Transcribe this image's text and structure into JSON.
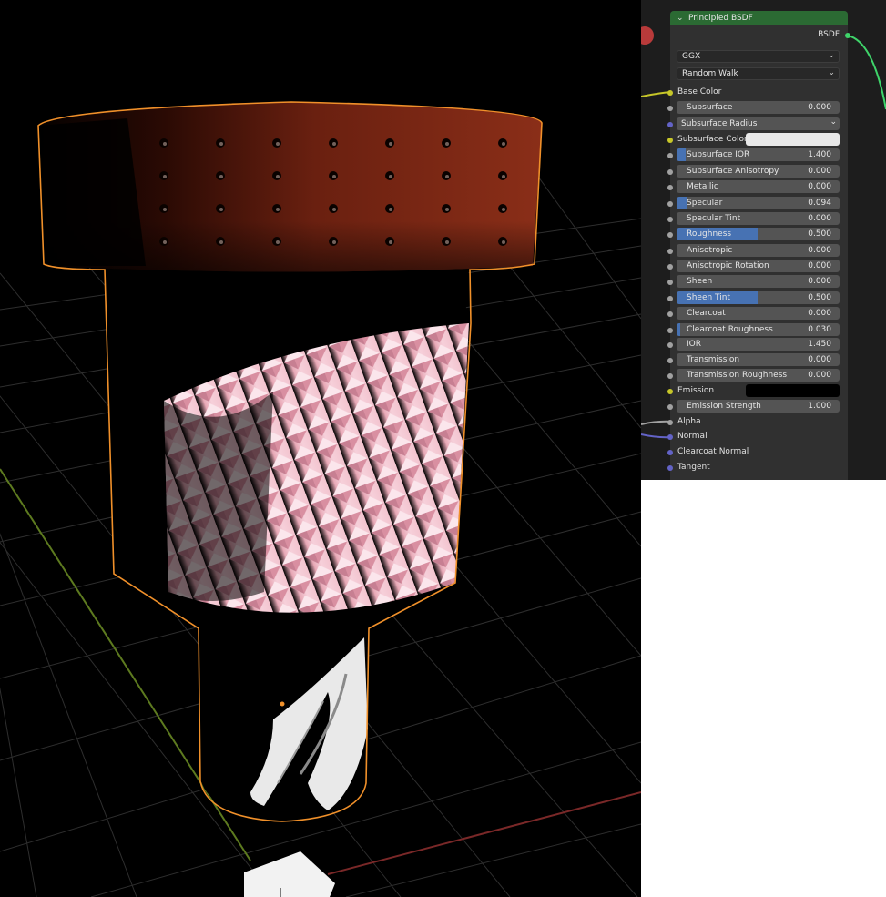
{
  "node": {
    "title": "Principled BSDF",
    "output_label": "BSDF",
    "distribution": "GGX",
    "subsurface_method": "Random Walk",
    "collapse_glyph": "⌄",
    "dropdown_arrow": "⌄"
  },
  "inputs": {
    "base_color": "Base Color",
    "subsurface": {
      "label": "Subsurface",
      "value": "0.000"
    },
    "subsurface_radius": "Subsurface Radius",
    "subsurface_color": "Subsurface Color",
    "subsurface_ior": {
      "label": "Subsurface IOR",
      "value": "1.400"
    },
    "subsurface_anisotropy": {
      "label": "Subsurface Anisotropy",
      "value": "0.000"
    },
    "metallic": {
      "label": "Metallic",
      "value": "0.000"
    },
    "specular": {
      "label": "Specular",
      "value": "0.094"
    },
    "specular_tint": {
      "label": "Specular Tint",
      "value": "0.000"
    },
    "roughness": {
      "label": "Roughness",
      "value": "0.500"
    },
    "anisotropic": {
      "label": "Anisotropic",
      "value": "0.000"
    },
    "anisotropic_rotation": {
      "label": "Anisotropic Rotation",
      "value": "0.000"
    },
    "sheen": {
      "label": "Sheen",
      "value": "0.000"
    },
    "sheen_tint": {
      "label": "Sheen Tint",
      "value": "0.500"
    },
    "clearcoat": {
      "label": "Clearcoat",
      "value": "0.000"
    },
    "clearcoat_roughness": {
      "label": "Clearcoat Roughness",
      "value": "0.030"
    },
    "ior": {
      "label": "IOR",
      "value": "1.450"
    },
    "transmission": {
      "label": "Transmission",
      "value": "0.000"
    },
    "transmission_roughness": {
      "label": "Transmission Roughness",
      "value": "0.000"
    },
    "emission": "Emission",
    "emission_strength": {
      "label": "Emission Strength",
      "value": "1.000"
    },
    "alpha": "Alpha",
    "normal": "Normal",
    "clearcoat_normal": "Clearcoat Normal",
    "tangent": "Tangent"
  },
  "colors": {
    "node_header": "#2b6a33",
    "slider_fill": "#4772b3",
    "selection_outline": "#f0902a",
    "subsurface_color_swatch": "#e8e8e8",
    "emission_color_swatch": "#000000",
    "socket_color": "#c7c729",
    "socket_float": "#a1a1a1",
    "socket_vector": "#6363c7",
    "socket_shader": "#3fd46a"
  },
  "icons": {
    "collapse": "chevron-down-icon",
    "dropdown": "chevron-down-icon",
    "sockets": "socket-dot-icon"
  }
}
